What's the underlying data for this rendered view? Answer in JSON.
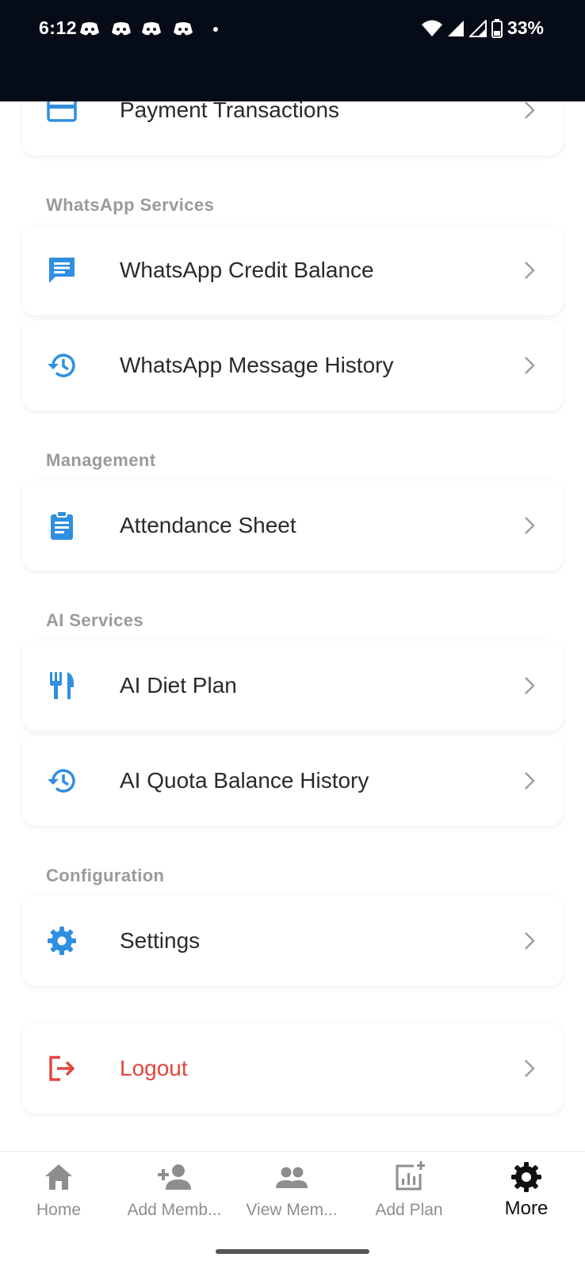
{
  "status_bar": {
    "time": "6:12",
    "battery": "33%"
  },
  "menu": {
    "payment_transactions": "Payment Transactions",
    "sections": {
      "whatsapp": "WhatsApp Services",
      "management": "Management",
      "ai": "AI Services",
      "configuration": "Configuration"
    },
    "whatsapp_credit_balance": "WhatsApp Credit Balance",
    "whatsapp_message_history": "WhatsApp Message History",
    "attendance_sheet": "Attendance Sheet",
    "ai_diet_plan": "AI Diet Plan",
    "ai_quota_balance_history": "AI Quota Balance History",
    "settings": "Settings",
    "logout": "Logout"
  },
  "bottom_nav": {
    "items": [
      {
        "label": "Home",
        "icon": "home-icon",
        "active": false
      },
      {
        "label": "Add Memb...",
        "icon": "person-add-icon",
        "active": false
      },
      {
        "label": "View Mem...",
        "icon": "group-icon",
        "active": false
      },
      {
        "label": "Add Plan",
        "icon": "add-chart-icon",
        "active": false
      },
      {
        "label": "More",
        "icon": "gear-icon",
        "active": true
      }
    ]
  },
  "colors": {
    "accent": "#2f8fe0",
    "logout": "#e3463d",
    "section_title": "#9a9a9a",
    "status_bar": "#060c17"
  }
}
